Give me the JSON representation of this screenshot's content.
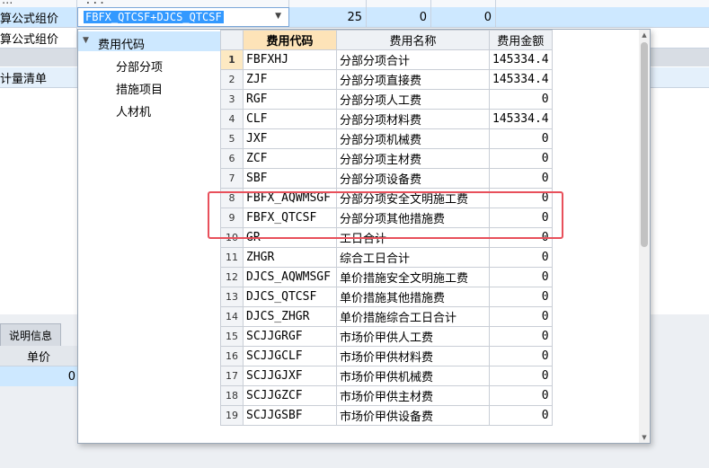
{
  "background": {
    "row0": {
      "label": "...",
      "formula_code": "...",
      "v1": "",
      "v2": "",
      "v3": ""
    },
    "row1": {
      "label": "算公式组价",
      "formula_value": "FBFX_QTCSF+DJCS_QTCSF",
      "v1": "25",
      "v2": "0",
      "v3": "0"
    },
    "row2": {
      "label": "算公式组价"
    },
    "row3": {
      "label": "计量清单"
    },
    "tab_label": "说明信息",
    "price_header": "单价",
    "price_value": "0"
  },
  "tree": {
    "root": "费用代码",
    "children": [
      "分部分项",
      "措施项目",
      "人材机"
    ]
  },
  "grid": {
    "columns": [
      "费用代码",
      "费用名称",
      "费用金额"
    ],
    "rows": [
      {
        "n": "1",
        "code": "FBFXHJ",
        "name": "分部分项合计",
        "amount": "145334.4"
      },
      {
        "n": "2",
        "code": "ZJF",
        "name": "分部分项直接费",
        "amount": "145334.4"
      },
      {
        "n": "3",
        "code": "RGF",
        "name": "分部分项人工费",
        "amount": "0"
      },
      {
        "n": "4",
        "code": "CLF",
        "name": "分部分项材料费",
        "amount": "145334.4"
      },
      {
        "n": "5",
        "code": "JXF",
        "name": "分部分项机械费",
        "amount": "0"
      },
      {
        "n": "6",
        "code": "ZCF",
        "name": "分部分项主材费",
        "amount": "0"
      },
      {
        "n": "7",
        "code": "SBF",
        "name": "分部分项设备费",
        "amount": "0"
      },
      {
        "n": "8",
        "code": "FBFX_AQWMSGF",
        "name": "分部分项安全文明施工费",
        "amount": "0"
      },
      {
        "n": "9",
        "code": "FBFX_QTCSF",
        "name": "分部分项其他措施费",
        "amount": "0"
      },
      {
        "n": "10",
        "code": "GR",
        "name": "工日合计",
        "amount": "0"
      },
      {
        "n": "11",
        "code": "ZHGR",
        "name": "综合工日合计",
        "amount": "0"
      },
      {
        "n": "12",
        "code": "DJCS_AQWMSGF",
        "name": "单价措施安全文明施工费",
        "amount": "0"
      },
      {
        "n": "13",
        "code": "DJCS_QTCSF",
        "name": "单价措施其他措施费",
        "amount": "0"
      },
      {
        "n": "14",
        "code": "DJCS_ZHGR",
        "name": "单价措施综合工日合计",
        "amount": "0"
      },
      {
        "n": "15",
        "code": "SCJJGRGF",
        "name": "市场价甲供人工费",
        "amount": "0"
      },
      {
        "n": "16",
        "code": "SCJJGCLF",
        "name": "市场价甲供材料费",
        "amount": "0"
      },
      {
        "n": "17",
        "code": "SCJJGJXF",
        "name": "市场价甲供机械费",
        "amount": "0"
      },
      {
        "n": "18",
        "code": "SCJJGZCF",
        "name": "市场价甲供主材费",
        "amount": "0"
      },
      {
        "n": "19",
        "code": "SCJJGSBF",
        "name": "市场价甲供设备费",
        "amount": "0"
      }
    ]
  },
  "colors": {
    "accent": "#3399ff",
    "highlight": "#e8505b",
    "selected_row": "#cde8ff"
  }
}
